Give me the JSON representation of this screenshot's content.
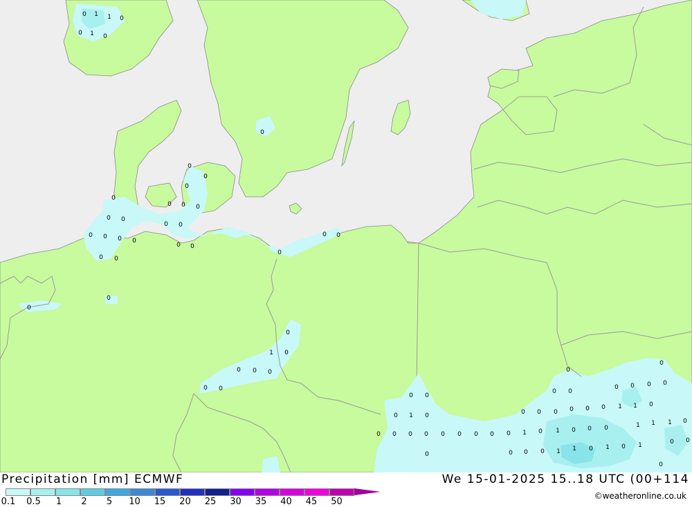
{
  "header": {
    "title_left": "Precipitation [mm] ECMWF",
    "title_right": "We 15-01-2025 15..18 UTC (00+114",
    "credit": "©weatheronline.co.uk"
  },
  "legend": {
    "colors": [
      "#c8f8f8",
      "#a8f0f0",
      "#88e4e8",
      "#5ccce0",
      "#40a8e0",
      "#3c88d8",
      "#2c58d0",
      "#2030c0",
      "#102090",
      "#8800f0",
      "#b400e8",
      "#d800e0",
      "#f000e0",
      "#c000b0"
    ],
    "arrow_color": "#a0009a",
    "labels": [
      "0.1",
      "0.5",
      "1",
      "2",
      "5",
      "10",
      "15",
      "20",
      "25",
      "30",
      "35",
      "40",
      "45",
      "50"
    ]
  },
  "colors": {
    "sea": "#eeeeee",
    "land": "#c8fa9e",
    "precip_light": "#c8f8f8",
    "precip_mid": "#a8f0f0",
    "precip_high": "#88e4e8",
    "border": "#9a9a9a"
  },
  "map_values": [
    {
      "v": "0"
    },
    {
      "v": "1"
    },
    {
      "v": "1"
    },
    {
      "v": "0"
    },
    {
      "v": "0"
    },
    {
      "v": "1"
    },
    {
      "v": "0"
    },
    {
      "v": "0"
    },
    {
      "v": "0"
    },
    {
      "v": "0"
    },
    {
      "v": "0"
    },
    {
      "v": "0"
    },
    {
      "v": "0"
    },
    {
      "v": "0"
    },
    {
      "v": "0"
    },
    {
      "v": "0"
    },
    {
      "v": "0"
    },
    {
      "v": "0"
    },
    {
      "v": "0"
    },
    {
      "v": "0"
    },
    {
      "v": "0"
    },
    {
      "v": "0"
    },
    {
      "v": "0"
    },
    {
      "v": "0"
    },
    {
      "v": "0"
    },
    {
      "v": "0"
    },
    {
      "v": "0"
    },
    {
      "v": "0"
    },
    {
      "v": "0"
    },
    {
      "v": "0"
    },
    {
      "v": "0"
    },
    {
      "v": "0"
    },
    {
      "v": "0"
    },
    {
      "v": "1"
    },
    {
      "v": "0"
    },
    {
      "v": "0"
    },
    {
      "v": "0"
    },
    {
      "v": "0"
    },
    {
      "v": "0"
    },
    {
      "v": "0"
    },
    {
      "v": "0"
    },
    {
      "v": "0"
    },
    {
      "v": "0"
    },
    {
      "v": "1"
    },
    {
      "v": "0"
    },
    {
      "v": "0"
    },
    {
      "v": "0"
    },
    {
      "v": "0"
    },
    {
      "v": "0"
    },
    {
      "v": "0"
    },
    {
      "v": "0"
    },
    {
      "v": "0"
    },
    {
      "v": "0"
    },
    {
      "v": "0"
    },
    {
      "v": "0"
    },
    {
      "v": "0"
    },
    {
      "v": "0"
    },
    {
      "v": "0"
    },
    {
      "v": "0"
    },
    {
      "v": "1"
    },
    {
      "v": "1"
    },
    {
      "v": "0"
    },
    {
      "v": "0"
    },
    {
      "v": "0"
    },
    {
      "v": "0"
    },
    {
      "v": "0"
    },
    {
      "v": "0"
    },
    {
      "v": "0"
    },
    {
      "v": "0"
    },
    {
      "v": "0"
    },
    {
      "v": "1"
    },
    {
      "v": "0"
    },
    {
      "v": "1"
    },
    {
      "v": "0"
    },
    {
      "v": "0"
    },
    {
      "v": "0"
    },
    {
      "v": "1"
    },
    {
      "v": "1"
    },
    {
      "v": "1"
    },
    {
      "v": "0"
    },
    {
      "v": "0"
    },
    {
      "v": "0"
    },
    {
      "v": "0"
    },
    {
      "v": "0"
    },
    {
      "v": "1"
    },
    {
      "v": "1"
    },
    {
      "v": "0"
    },
    {
      "v": "1"
    },
    {
      "v": "0"
    },
    {
      "v": "1"
    },
    {
      "v": "0"
    },
    {
      "v": "0"
    },
    {
      "v": "0"
    },
    {
      "v": "0"
    }
  ]
}
